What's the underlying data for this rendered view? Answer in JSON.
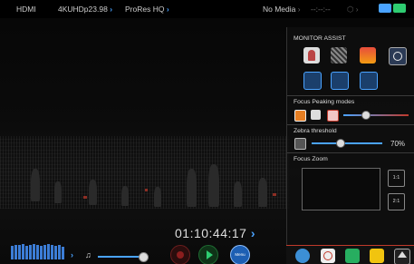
{
  "status_bar": {
    "input": "HDMI",
    "format": "4KUHDp23.98",
    "codec": "ProRes HQ",
    "media": "No Media",
    "remaining": "--:--:--"
  },
  "video": {
    "timecode": "01:10:44:17"
  },
  "controls": {
    "menu_label": "Menu"
  },
  "monitor_assist": {
    "title": "MONITOR ASSIST",
    "focus_peaking_title": "Focus Peaking modes",
    "zebra_title": "Zebra threshold",
    "zebra_value": "70%",
    "zebra_level": 0.55,
    "peaking_level": 0.35,
    "focus_zoom_title": "Focus Zoom",
    "zoom_1": "1:1",
    "zoom_2": "2:1"
  },
  "colors": {
    "accent_blue": "#4aa3ff",
    "accent_red": "#c0392b",
    "green": "#2ecc71",
    "yellow": "#f1c40f"
  },
  "icons": [
    "headphone-icon",
    "record-icon",
    "play-icon",
    "menu-icon",
    "scopes-icon",
    "crosshair-icon",
    "flag-icon",
    "notes-icon",
    "eject-icon"
  ]
}
